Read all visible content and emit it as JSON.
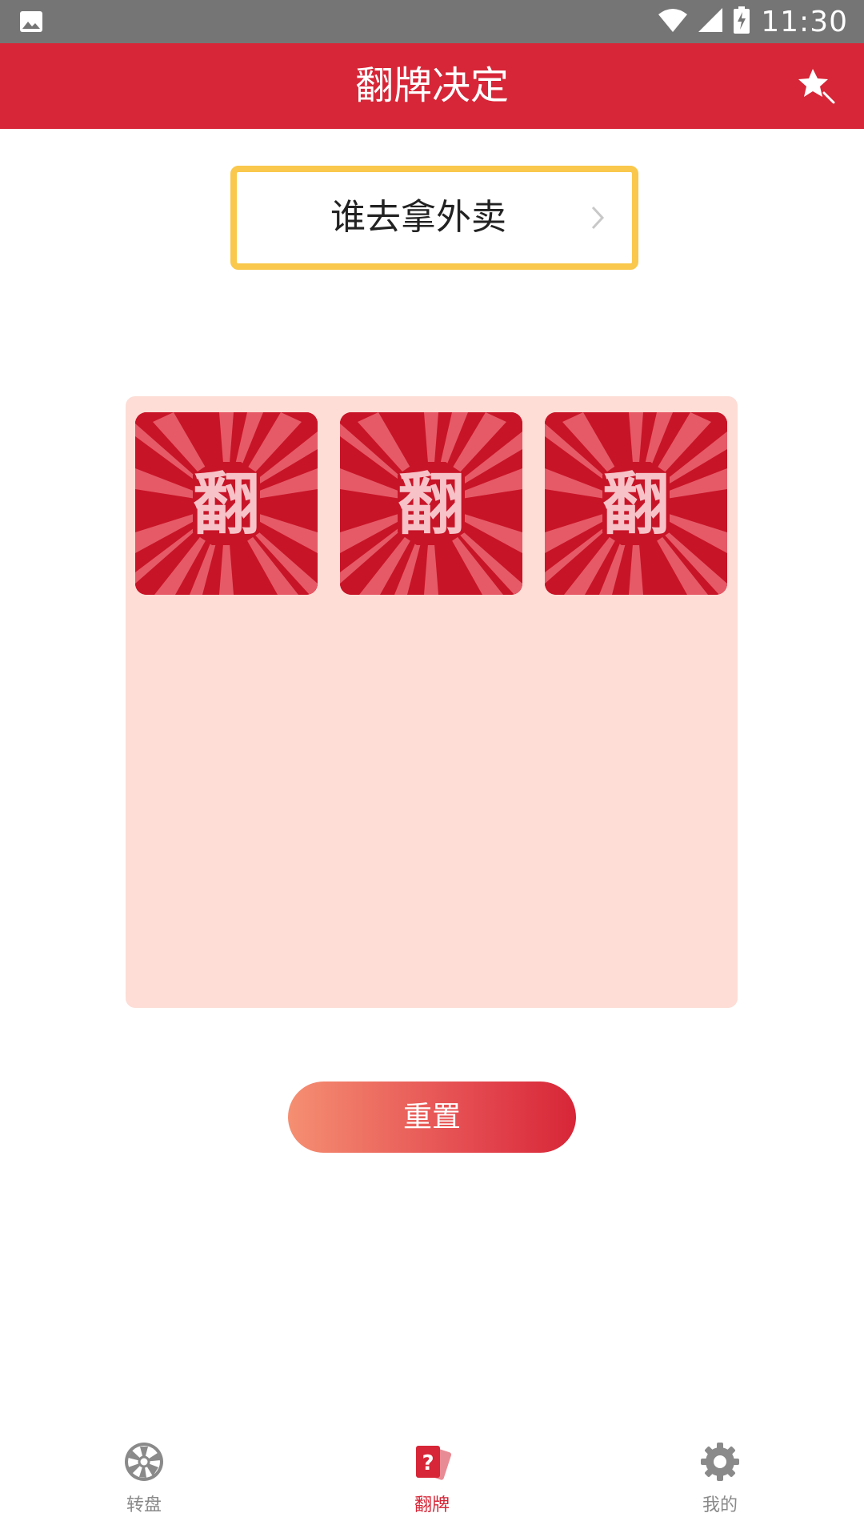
{
  "status_bar": {
    "time": "11:30",
    "icons": [
      "image-icon",
      "wifi-icon",
      "signal-icon",
      "battery-charging-icon"
    ]
  },
  "app_bar": {
    "title": "翻牌决定",
    "action_icon": "magic-wand-star-icon"
  },
  "topic_selector": {
    "label": "谁去拿外卖",
    "icon": "chevron-right-icon",
    "border_color": "#f9c84c"
  },
  "cards": [
    {
      "glyph": "翻"
    },
    {
      "glyph": "翻"
    },
    {
      "glyph": "翻"
    }
  ],
  "reset_button": {
    "label": "重置"
  },
  "bottom_nav": {
    "items": [
      {
        "label": "转盘",
        "icon": "wheel-icon",
        "active": false
      },
      {
        "label": "翻牌",
        "icon": "flip-card-icon",
        "active": true
      },
      {
        "label": "我的",
        "icon": "gear-icon",
        "active": false
      }
    ]
  },
  "colors": {
    "primary": "#d72637",
    "board_background": "#fdddd6",
    "card_red": "#c81427",
    "status_bar": "#757575"
  }
}
